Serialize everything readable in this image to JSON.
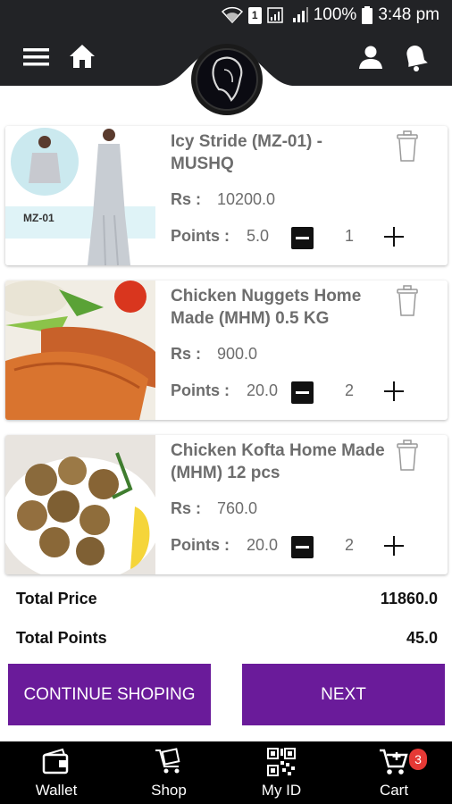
{
  "status_bar": {
    "battery": "100%",
    "time": "3:48 pm",
    "sim_label": "1",
    "icons": [
      "wifi-icon",
      "sim-icon",
      "signal-icon",
      "battery-icon"
    ]
  },
  "header": {
    "icons": [
      "menu-icon",
      "home-icon",
      "logo",
      "user-icon",
      "bell-icon"
    ]
  },
  "cart": {
    "rs_label": "Rs :",
    "points_label": "Points :",
    "items": [
      {
        "title": "Icy Stride (MZ-01) - MUSHQ",
        "price": "10200.0",
        "points": "5.0",
        "qty": "1",
        "image_tag": "MZ-01"
      },
      {
        "title": "Chicken Nuggets Home Made (MHM)  0.5 KG",
        "price": "900.0",
        "points": "20.0",
        "qty": "2"
      },
      {
        "title": "Chicken Kofta Home Made (MHM) 12 pcs",
        "price": "760.0",
        "points": "20.0",
        "qty": "2"
      }
    ]
  },
  "totals": {
    "price_label": "Total Price",
    "price_value": "11860.0",
    "points_label": "Total Points",
    "points_value": "45.0"
  },
  "actions": {
    "continue_label": "CONTINUE SHOPING",
    "next_label": "NEXT"
  },
  "bottom_nav": {
    "items": [
      {
        "label": "Wallet",
        "icon": "wallet-icon"
      },
      {
        "label": "Shop",
        "icon": "shop-cart-icon"
      },
      {
        "label": "My ID",
        "icon": "qr-code-icon"
      },
      {
        "label": "Cart",
        "icon": "cart-icon",
        "badge": "3"
      }
    ]
  },
  "colors": {
    "accent": "#6a1b9a",
    "status_bar": "#222326",
    "header_dark": "#222326",
    "nav_bg": "#000000",
    "badge": "#e53935"
  }
}
